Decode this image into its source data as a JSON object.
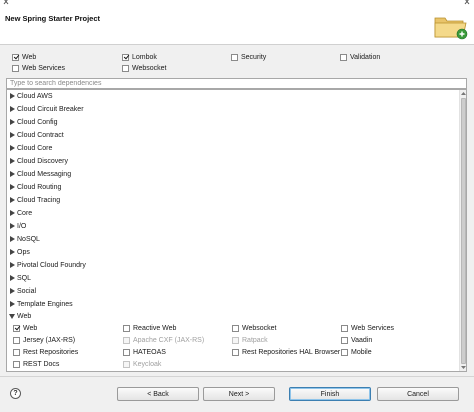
{
  "dialog": {
    "title": "New Spring Starter Project"
  },
  "selected_checks": [
    {
      "label": "Web",
      "checked": true
    },
    {
      "label": "Lombok",
      "checked": true
    },
    {
      "label": "Security",
      "checked": false
    },
    {
      "label": "Validation",
      "checked": false
    },
    {
      "label": "Web Services",
      "checked": false
    },
    {
      "label": "Websocket",
      "checked": false
    }
  ],
  "search": {
    "placeholder": "Type to search dependencies",
    "value": ""
  },
  "categories": [
    {
      "label": "Cloud AWS",
      "expanded": false
    },
    {
      "label": "Cloud Circuit Breaker",
      "expanded": false
    },
    {
      "label": "Cloud Config",
      "expanded": false
    },
    {
      "label": "Cloud Contract",
      "expanded": false
    },
    {
      "label": "Cloud Core",
      "expanded": false
    },
    {
      "label": "Cloud Discovery",
      "expanded": false
    },
    {
      "label": "Cloud Messaging",
      "expanded": false
    },
    {
      "label": "Cloud Routing",
      "expanded": false
    },
    {
      "label": "Cloud Tracing",
      "expanded": false
    },
    {
      "label": "Core",
      "expanded": false
    },
    {
      "label": "I/O",
      "expanded": false
    },
    {
      "label": "NoSQL",
      "expanded": false
    },
    {
      "label": "Ops",
      "expanded": false
    },
    {
      "label": "Pivotal Cloud Foundry",
      "expanded": false
    },
    {
      "label": "SQL",
      "expanded": false
    },
    {
      "label": "Social",
      "expanded": false
    },
    {
      "label": "Template Engines",
      "expanded": false
    },
    {
      "label": "Web",
      "expanded": true
    }
  ],
  "web_items": [
    {
      "label": "Web",
      "checked": true,
      "disabled": false
    },
    {
      "label": "Reactive Web",
      "checked": false,
      "disabled": false
    },
    {
      "label": "Websocket",
      "checked": false,
      "disabled": false
    },
    {
      "label": "Web Services",
      "checked": false,
      "disabled": false
    },
    {
      "label": "Jersey (JAX-RS)",
      "checked": false,
      "disabled": false
    },
    {
      "label": "Apache CXF (JAX-RS)",
      "checked": false,
      "disabled": true
    },
    {
      "label": "Ratpack",
      "checked": false,
      "disabled": true
    },
    {
      "label": "Vaadin",
      "checked": false,
      "disabled": false
    },
    {
      "label": "Rest Repositories",
      "checked": false,
      "disabled": false
    },
    {
      "label": "HATEOAS",
      "checked": false,
      "disabled": false
    },
    {
      "label": "Rest Repositories HAL Browser",
      "checked": false,
      "disabled": false
    },
    {
      "label": "Mobile",
      "checked": false,
      "disabled": false
    },
    {
      "label": "REST Docs",
      "checked": false,
      "disabled": false
    },
    {
      "label": "Keycloak",
      "checked": false,
      "disabled": true
    }
  ],
  "buttons": {
    "help": "?",
    "back": "< Back",
    "next": "Next >",
    "finish": "Finish",
    "cancel": "Cancel"
  },
  "icons": {
    "help": "help-icon",
    "wizard": "folder-wizard-icon",
    "close": "close-icon",
    "collapsed": "triangle-right-icon",
    "expanded": "triangle-down-icon"
  },
  "colors": {
    "finish_border": "#3c7fb1",
    "wizard_folder": "#e9c46a",
    "wizard_badge": "#3a9a3a"
  }
}
